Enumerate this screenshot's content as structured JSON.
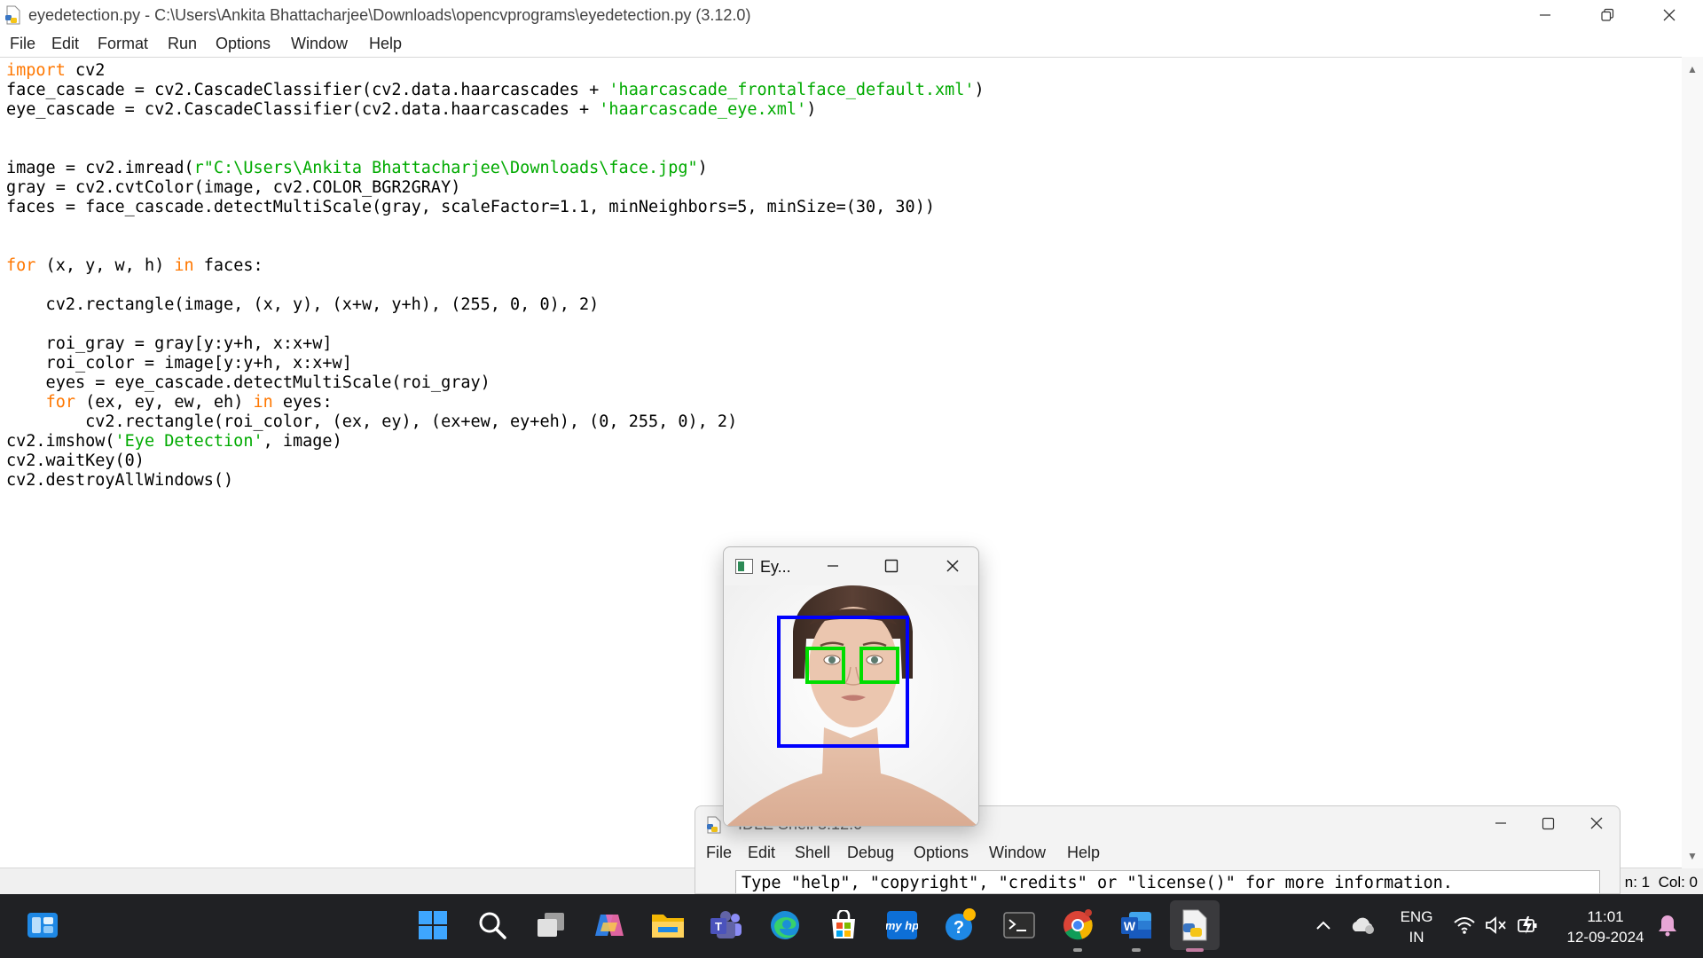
{
  "editor": {
    "title": "eyedetection.py - C:\\Users\\Ankita Bhattacharjee\\Downloads\\opencvprograms\\eyedetection.py (3.12.0)",
    "menu": [
      "File",
      "Edit",
      "Format",
      "Run",
      "Options",
      "Window",
      "Help"
    ],
    "code": [
      [
        {
          "t": "import",
          "c": "kw"
        },
        {
          "t": " cv2",
          "c": "id"
        }
      ],
      [
        {
          "t": "face_cascade = cv2.CascadeClassifier(cv2.data.haarcascades + ",
          "c": "id"
        },
        {
          "t": "'haarcascade_frontalface_default.xml'",
          "c": "str"
        },
        {
          "t": ")",
          "c": "id"
        }
      ],
      [
        {
          "t": "eye_cascade = cv2.CascadeClassifier(cv2.data.haarcascades + ",
          "c": "id"
        },
        {
          "t": "'haarcascade_eye.xml'",
          "c": "str"
        },
        {
          "t": ")",
          "c": "id"
        }
      ],
      [],
      [],
      [
        {
          "t": "image = cv2.imread(",
          "c": "id"
        },
        {
          "t": "r\"C:\\Users\\Ankita Bhattacharjee\\Downloads\\face.jpg\"",
          "c": "str"
        },
        {
          "t": ")",
          "c": "id"
        }
      ],
      [
        {
          "t": "gray = cv2.cvtColor(image, cv2.COLOR_BGR2GRAY)",
          "c": "id"
        }
      ],
      [
        {
          "t": "faces = face_cascade.detectMultiScale(gray, scaleFactor=1.1, minNeighbors=5, minSize=(30, 30))",
          "c": "id"
        }
      ],
      [],
      [],
      [
        {
          "t": "for",
          "c": "kw"
        },
        {
          "t": " (x, y, w, h) ",
          "c": "id"
        },
        {
          "t": "in",
          "c": "kw"
        },
        {
          "t": " faces:",
          "c": "id"
        }
      ],
      [],
      [
        {
          "t": "    cv2.rectangle(image, (x, y), (x+w, y+h), (255, 0, 0), 2)",
          "c": "id"
        }
      ],
      [],
      [
        {
          "t": "    roi_gray = gray[y:y+h, x:x+w]",
          "c": "id"
        }
      ],
      [
        {
          "t": "    roi_color = image[y:y+h, x:x+w]",
          "c": "id"
        }
      ],
      [
        {
          "t": "    eyes = eye_cascade.detectMultiScale(roi_gray)",
          "c": "id"
        }
      ],
      [
        {
          "t": "    ",
          "c": "id"
        },
        {
          "t": "for",
          "c": "kw"
        },
        {
          "t": " (ex, ey, ew, eh) ",
          "c": "id"
        },
        {
          "t": "in",
          "c": "kw"
        },
        {
          "t": " eyes:",
          "c": "id"
        }
      ],
      [
        {
          "t": "        cv2.rectangle(roi_color, (ex, ey), (ex+ew, ey+eh), (0, 255, 0), 2)",
          "c": "id"
        }
      ],
      [
        {
          "t": "cv2.imshow(",
          "c": "id"
        },
        {
          "t": "'Eye Detection'",
          "c": "str"
        },
        {
          "t": ", image)",
          "c": "id"
        }
      ],
      [
        {
          "t": "cv2.waitKey(0)",
          "c": "id"
        }
      ],
      [
        {
          "t": "cv2.destroyAllWindows()",
          "c": "id"
        }
      ]
    ],
    "status": "n: 1  Col: 0"
  },
  "shell": {
    "title": "IDLE Shell 3.12.0",
    "menu": [
      "File",
      "Edit",
      "Shell",
      "Debug",
      "Options",
      "Window",
      "Help"
    ],
    "line": "Type \"help\", \"copyright\", \"credits\" or \"license()\" for more information."
  },
  "cv_window": {
    "title": "Ey...",
    "face_box_color": "#0000ff",
    "eye_box_color": "#00dd00"
  },
  "taskbar": {
    "icons": [
      "start-icon",
      "search-icon",
      "task-view-icon",
      "copilot-icon",
      "file-explorer-icon",
      "teams-icon",
      "edge-icon",
      "microsoft-store-icon",
      "myhp-icon",
      "help-icon",
      "terminal-icon",
      "chrome-icon",
      "word-icon",
      "python-idle-icon"
    ],
    "lang_1": "ENG",
    "lang_2": "IN",
    "time": "11:01",
    "date": "12-09-2024"
  },
  "colors": {
    "keyword": "#ff7700",
    "string": "#00aa00",
    "taskbar_bg": "#202124"
  }
}
